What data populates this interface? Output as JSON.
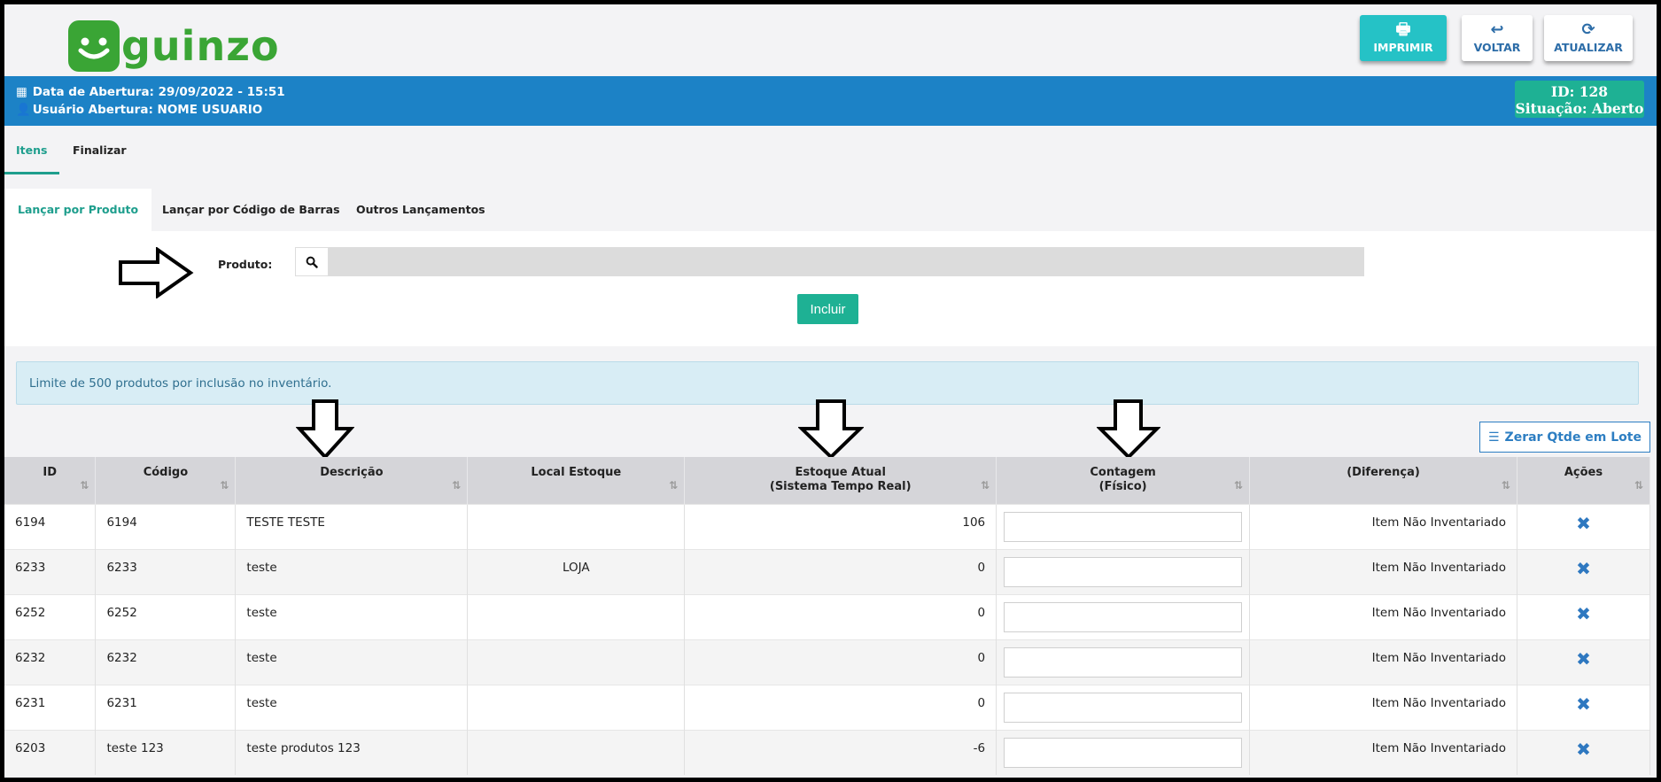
{
  "brand": {
    "logo_text": "guinzo",
    "color": "#3aa535"
  },
  "toolbar": {
    "print_label": "IMPRIMIR",
    "back_label": "VOLTAR",
    "refresh_label": "ATUALIZAR"
  },
  "info": {
    "opening_date": "Data de Abertura: 29/09/2022 - 15:51",
    "opening_user": "Usuário Abertura: NOME USUARIO",
    "id_text": "ID: 128",
    "status_text": "Situação: Aberto"
  },
  "main_tabs": [
    {
      "label": "Itens",
      "active": true
    },
    {
      "label": "Finalizar",
      "active": false
    }
  ],
  "sub_tabs": [
    {
      "label": "Lançar por Produto",
      "active": true
    },
    {
      "label": "Lançar por Código de Barras",
      "active": false
    },
    {
      "label": "Outros Lançamentos",
      "active": false
    }
  ],
  "product_form": {
    "label": "Produto:",
    "input_value": "",
    "include_label": "Incluir"
  },
  "notice": "Limite de 500 produtos por inclusão no inventário.",
  "batch_button": "Zerar Qtde em Lote",
  "table": {
    "headers": [
      "ID",
      "Código",
      "Descrição",
      "Local Estoque",
      "Estoque Atual\n(Sistema Tempo Real)",
      "Contagem\n(Físico)",
      "(Diferença)",
      "Ações"
    ],
    "rows": [
      {
        "id": "6194",
        "code": "6194",
        "desc": "TESTE TESTE",
        "local": "",
        "stock": "106",
        "count": "",
        "diff": "Item Não Inventariado"
      },
      {
        "id": "6233",
        "code": "6233",
        "desc": "teste",
        "local": "LOJA",
        "stock": "0",
        "count": "",
        "diff": "Item Não Inventariado"
      },
      {
        "id": "6252",
        "code": "6252",
        "desc": "teste",
        "local": "",
        "stock": "0",
        "count": "",
        "diff": "Item Não Inventariado"
      },
      {
        "id": "6232",
        "code": "6232",
        "desc": "teste",
        "local": "",
        "stock": "0",
        "count": "",
        "diff": "Item Não Inventariado"
      },
      {
        "id": "6231",
        "code": "6231",
        "desc": "teste",
        "local": "",
        "stock": "0",
        "count": "",
        "diff": "Item Não Inventariado"
      },
      {
        "id": "6203",
        "code": "teste 123",
        "desc": "teste produtos 123",
        "local": "",
        "stock": "-6",
        "count": "",
        "diff": "Item Não Inventariado"
      }
    ]
  },
  "colors": {
    "info_bar": "#1c82c6",
    "accent": "#1eb194",
    "print_button": "#25c2c6",
    "notice_bg": "#d8edf5"
  }
}
